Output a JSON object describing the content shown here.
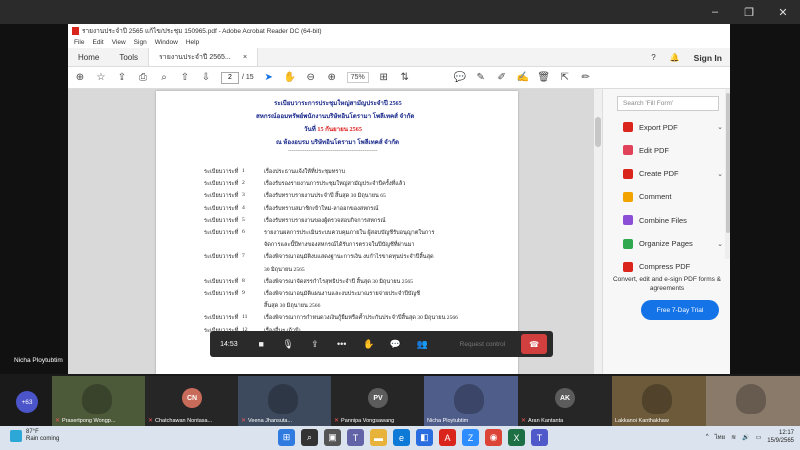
{
  "zoom": {
    "presenter": "Nicha Ploytubtim",
    "window_controls": [
      "–",
      "❐",
      "✕"
    ]
  },
  "acrobat": {
    "window_title": "รายงานประจำปี 2565 แก้ไข/ประชุม 150965.pdf - Adobe Acrobat Reader DC (64-bit)",
    "menu": [
      "File",
      "Edit",
      "View",
      "Sign",
      "Window",
      "Help"
    ],
    "tabs": {
      "home": "Home",
      "tools": "Tools",
      "document": "รายงานประจำปี 2565..."
    },
    "sign_in": "Sign In",
    "page_current": "2",
    "page_total": "/ 15",
    "zoom": "75%",
    "search_placeholder": "Search 'Fill Form'",
    "tools": [
      {
        "label": "Export PDF",
        "color": "#d9251c",
        "chevron": true
      },
      {
        "label": "Edit PDF",
        "color": "#e0425a",
        "chevron": false
      },
      {
        "label": "Create PDF",
        "color": "#d9251c",
        "chevron": true
      },
      {
        "label": "Comment",
        "color": "#f2a300",
        "chevron": false
      },
      {
        "label": "Combine Files",
        "color": "#8a4fd6",
        "chevron": false
      },
      {
        "label": "Organize Pages",
        "color": "#2fa84f",
        "chevron": true
      },
      {
        "label": "Compress PDF",
        "color": "#d9251c",
        "chevron": false
      }
    ],
    "promo": "Convert, edit and e-sign PDF forms & agreements",
    "trial_button": "Free 7-Day Trial"
  },
  "document": {
    "header1": "ระเบียบวาระการประชุมใหญ่สามัญประจำปี 2565",
    "header2": "สหกรณ์ออมทรัพย์พนักงานบริษัทอินโดรามา โพลีเทคส์ จำกัด",
    "header3_prefix": "วันที่",
    "header3_date": "15 กันยายน 2565",
    "header4": "ณ ห้องอบรม บริษัทอินโดรามา โพลีเทคส์ จำกัด",
    "divider": "------------------------------------------------",
    "agenda": [
      {
        "key": "ระเบียบวาระที่",
        "num": "1",
        "text": "เรื่องประธานแจ้งให้ที่ประชุมทราบ"
      },
      {
        "key": "ระเบียบวาระที่",
        "num": "2",
        "text": "เรื่องรับรองรายงานการประชุมใหญ่สามัญประจำปีครั้งที่แล้ว"
      },
      {
        "key": "ระเบียบวาระที่",
        "num": "3",
        "text": "เรื่องรับทราบรายงานประจำปี สิ้นสุด 30 มิถุนายน 65"
      },
      {
        "key": "ระเบียบวาระที่",
        "num": "4",
        "text": "เรื่องรับทราบสมาชิกเข้าใหม่-ลาออกของสหกรณ์"
      },
      {
        "key": "ระเบียบวาระที่",
        "num": "5",
        "text": "เรื่องรับทราบรายงานของผู้ตรวจสอบกิจการสหกรณ์"
      },
      {
        "key": "ระเบียบวาระที่",
        "num": "6",
        "text": "รายงานผลการประเมินระบบควบคุมภายใน ผู้สอบบัญชีรับอนุญาตในการ"
      },
      {
        "key": "",
        "num": "",
        "text": "จัดการและนี้ปีทางของสหกรณ์ได้รับการตรวจในปีบัญชีที่ผ่านมา"
      },
      {
        "key": "ระเบียบวาระที่",
        "num": "7",
        "text": "เรื่องพิจารณาอนุมัติงบแสดงฐานะการเงิน งบกำไรขาดทุนประจำปีสิ้นสุด"
      },
      {
        "key": "",
        "num": "",
        "text": "30 มิถุนายน 2565"
      },
      {
        "key": "ระเบียบวาระที่",
        "num": "8",
        "text": "เรื่องพิจารณาจัดสรรกำไรสุทธิประจำปี สิ้นสุด 30 มิถุนายน 2565"
      },
      {
        "key": "ระเบียบวาระที่",
        "num": "9",
        "text": "เรื่องพิจารณาอนุมัติแผนงานและงบประมาณรายจ่ายประจำปีบัญชี"
      },
      {
        "key": "",
        "num": "",
        "text": "สิ้นสุด 30 มิถุนายน 2566"
      },
      {
        "key": "ระเบียบวาระที่",
        "num": "11",
        "text": "เรื่องพิจารณาการกำหนดวงเงินกู้ยืมหรือค้ำประกันประจำปีสิ้นสุด 30 มิถุนายน 2566"
      },
      {
        "key": "ระเบียบวาระที่",
        "num": "12",
        "text": "เรื่องอื่นๆ (ถ้ามี)"
      }
    ]
  },
  "meeting": {
    "timer": "14:53",
    "request_control": "Request control"
  },
  "participants": {
    "more_count": "+63",
    "tiles": [
      {
        "name": "Prasertpong Wongp...",
        "initials": "",
        "bg": "#4d5a3a",
        "muted": true
      },
      {
        "name": "Chatchawan Nontasa...",
        "initials": "CN",
        "bg": "#c96b5a",
        "muted": true
      },
      {
        "name": "Veena Jhansuta...",
        "initials": "",
        "bg": "#3d4a5e",
        "muted": true
      },
      {
        "name": "Pannipa Vongsawang",
        "initials": "PV",
        "bg": "#5c5c5c",
        "muted": true
      },
      {
        "name": "Nicha Ploytubtim",
        "initials": "",
        "bg": "#4f5d8a",
        "muted": false
      },
      {
        "name": "Aran Kantanta",
        "initials": "AK",
        "bg": "#5c5c5c",
        "muted": true
      },
      {
        "name": "Lakkanoi Kanthakhaw",
        "initials": "",
        "bg": "#6c5a3a",
        "muted": false
      },
      {
        "name": "",
        "initials": "",
        "bg": "#8a7a6a",
        "muted": false
      }
    ]
  },
  "taskbar": {
    "temp": "87°F",
    "weather": "Rain coming",
    "lang": "ไทย",
    "time": "12:17",
    "date": "15/9/2565"
  }
}
